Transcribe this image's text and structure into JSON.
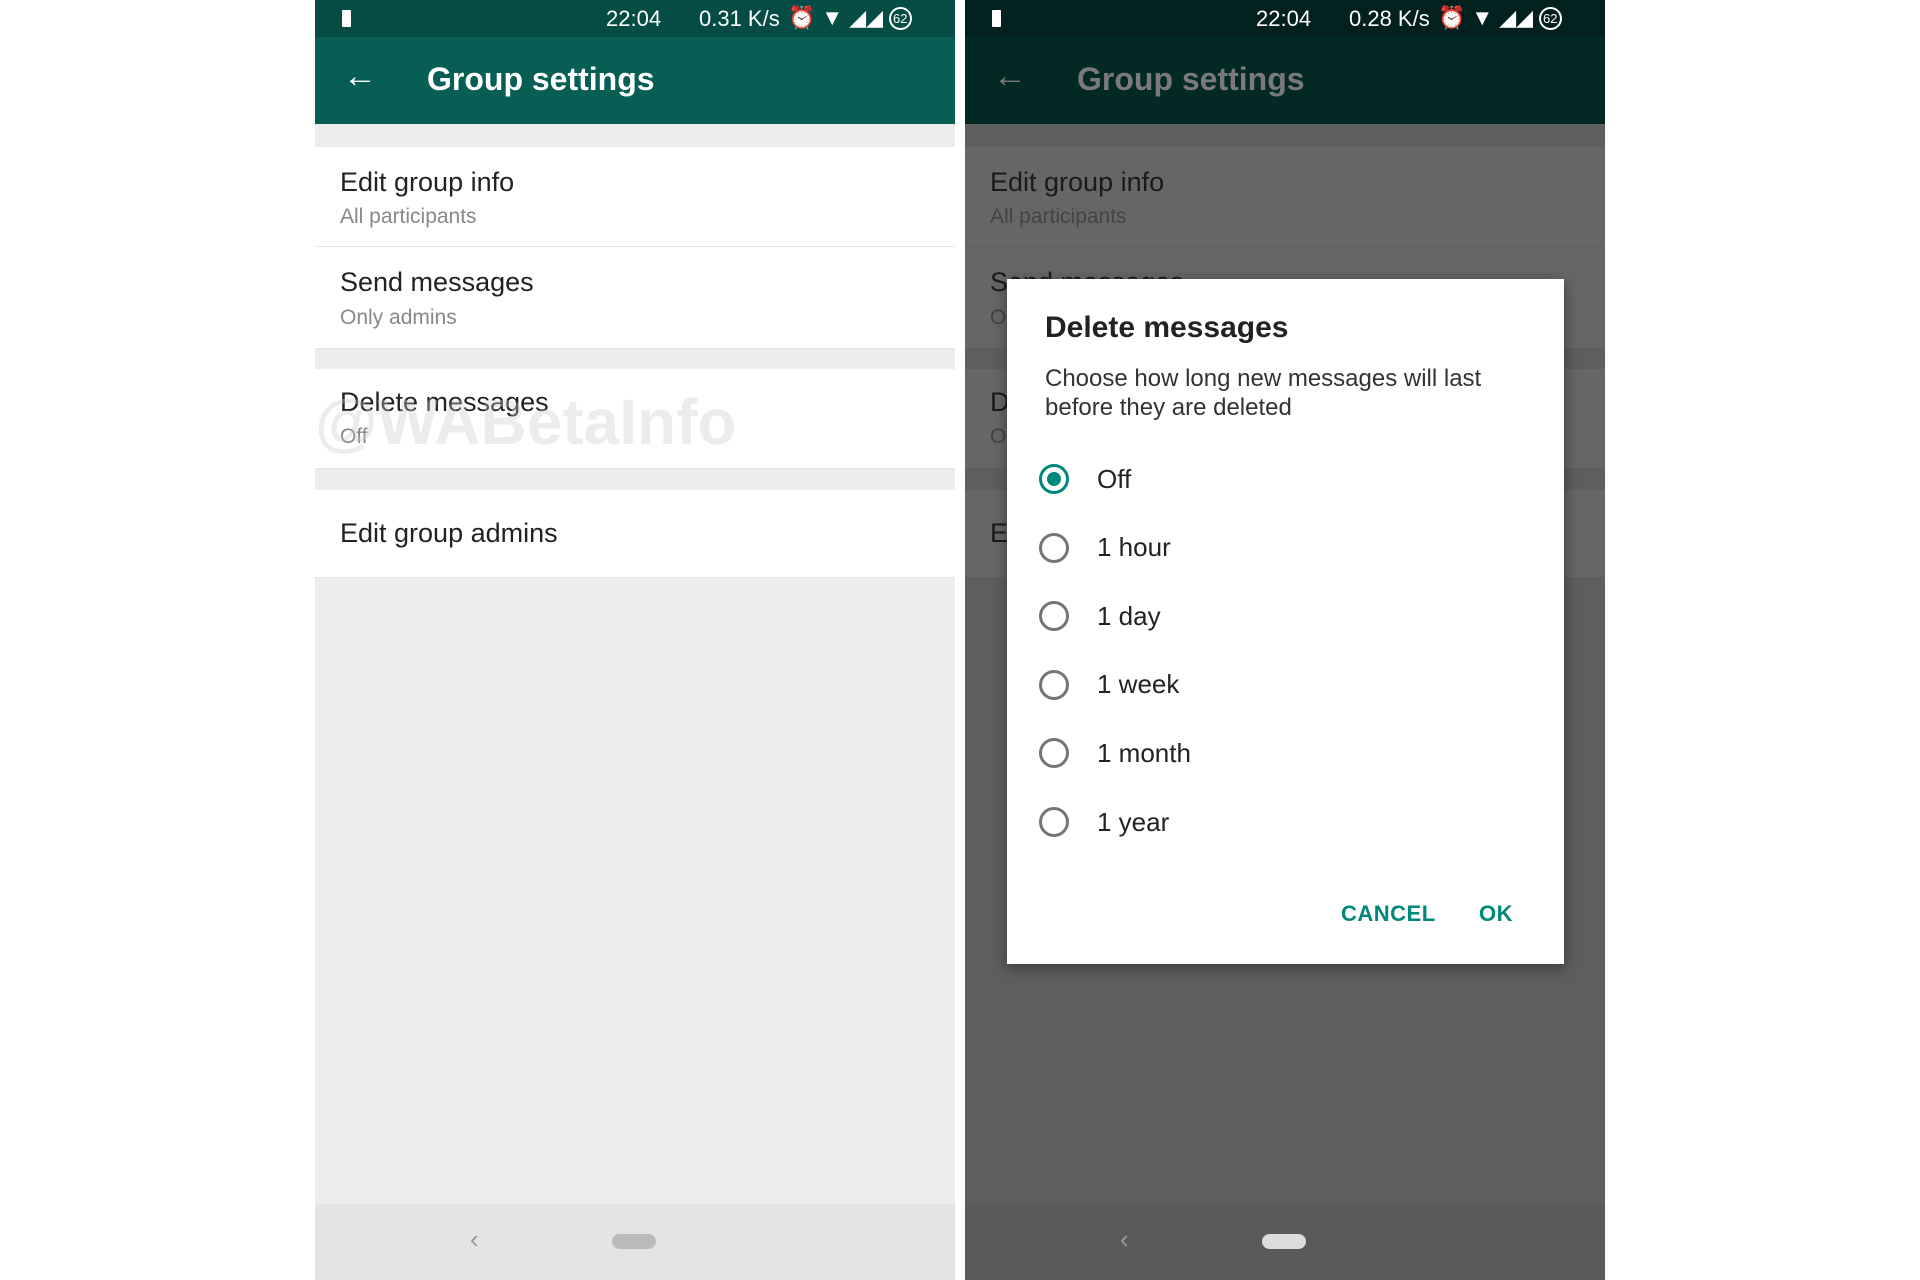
{
  "status_left": {
    "time": "22:04",
    "speed": "0.31 K/s",
    "battery": "62"
  },
  "status_right": {
    "time": "22:04",
    "speed": "0.28 K/s",
    "battery": "62"
  },
  "appbar": {
    "title": "Group settings",
    "back_icon": "arrow-left"
  },
  "settings": [
    {
      "title": "Edit group info",
      "subtitle": "All participants"
    },
    {
      "title": "Send messages",
      "subtitle": "Only admins"
    },
    {
      "title": "Delete messages",
      "subtitle": "Off"
    },
    {
      "title": "Edit group admins"
    }
  ],
  "watermark": "@WABetaInfo",
  "dialog": {
    "title": "Delete messages",
    "message": "Choose how long new messages will last before they are deleted",
    "options": [
      "Off",
      "1 hour",
      "1 day",
      "1 week",
      "1 month",
      "1 year"
    ],
    "selected": "Off",
    "cancel": "CANCEL",
    "ok": "OK"
  },
  "colors": {
    "accent": "#00897b",
    "appbar": "#075e54",
    "statusbar": "#054d44"
  }
}
